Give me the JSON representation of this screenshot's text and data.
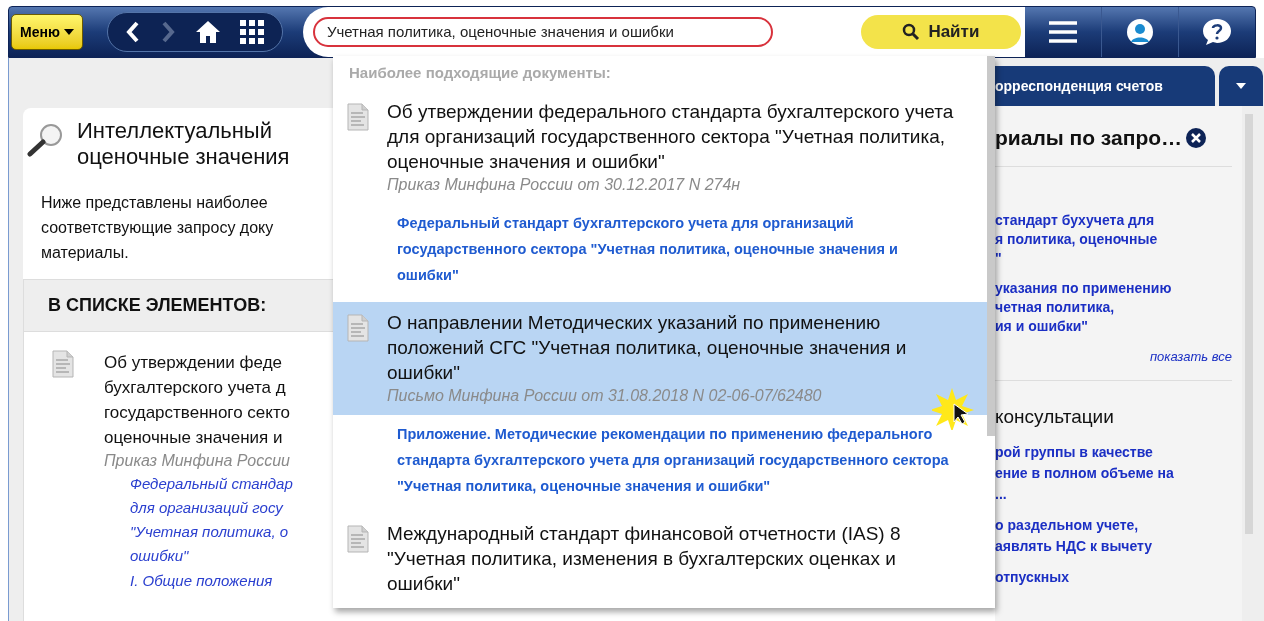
{
  "toolbar": {
    "menu_button": "Меню",
    "search": {
      "value": "Учетная политика, оценочные значения и ошибки"
    },
    "find_button": "Найти",
    "forward_disabled": true
  },
  "left_panel": {
    "title_lines": [
      "Интеллектуальный",
      "оценочные значения"
    ],
    "description_lines": [
      "Ниже представлены наиболее",
      "соответствующие запросу доку",
      "материалы."
    ],
    "section_heading": "В СПИСКЕ ЭЛЕМЕНТОВ:",
    "document": {
      "title_lines": [
        "Об утверждении феде",
        "бухгалтерского учета д",
        "государственного секто",
        "оценочные значения и"
      ],
      "source": "Приказ Минфина России",
      "link_lines": [
        "Федеральный стандар",
        "для организаций госу",
        "\"Учетная политика, о",
        "ошибки\""
      ],
      "section_link": "I. Общие положения"
    }
  },
  "suggestions": {
    "heading": "Наиболее подходящие документы:",
    "items": [
      {
        "title": "Об утверждении федерального стандарта бухгалтерского учета для организаций государственного сектора \"Учетная политика, оценочные значения и ошибки\"",
        "source": "Приказ Минфина России от 30.12.2017 N 274н",
        "link": "Федеральный стандарт бухгалтерского учета для организаций государственного сектора \"Учетная политика, оценочные значения и ошибки\"",
        "selected": false
      },
      {
        "title": "О направлении Методических указаний по применению положений СГС \"Учетная политика, оценочные значения и ошибки\"",
        "source": "Письмо Минфина России от 31.08.2018 N 02-06-07/62480",
        "link": "Приложение. Методические рекомендации по применению федерального стандарта бухгалтерского учета для организаций государственного сектора \"Учетная политика, оценочные значения и ошибки\"",
        "selected": true
      },
      {
        "title": "Международный стандарт финансовой отчетности (IAS) 8 \"Учетная политика, изменения в бухгалтерских оценках и ошибки\"",
        "selected": false
      }
    ]
  },
  "right_panel": {
    "tab": "орреспонденция счетов",
    "heading": "риалы по запро…",
    "materials": [
      [
        "стандарт бухучета для",
        "я политика, оценочные",
        "\""
      ],
      [
        "указания по применению",
        "четная политика,",
        "ия и ошибки\""
      ]
    ],
    "show_all": "показать все",
    "consultations_heading": "консультации",
    "consultations": [
      [
        "рой группы в качестве",
        "ение в полном объеме на",
        "..."
      ],
      [
        "о раздельном учете,",
        "аявлять НДС к вычету"
      ],
      [
        "отпускных"
      ]
    ]
  }
}
